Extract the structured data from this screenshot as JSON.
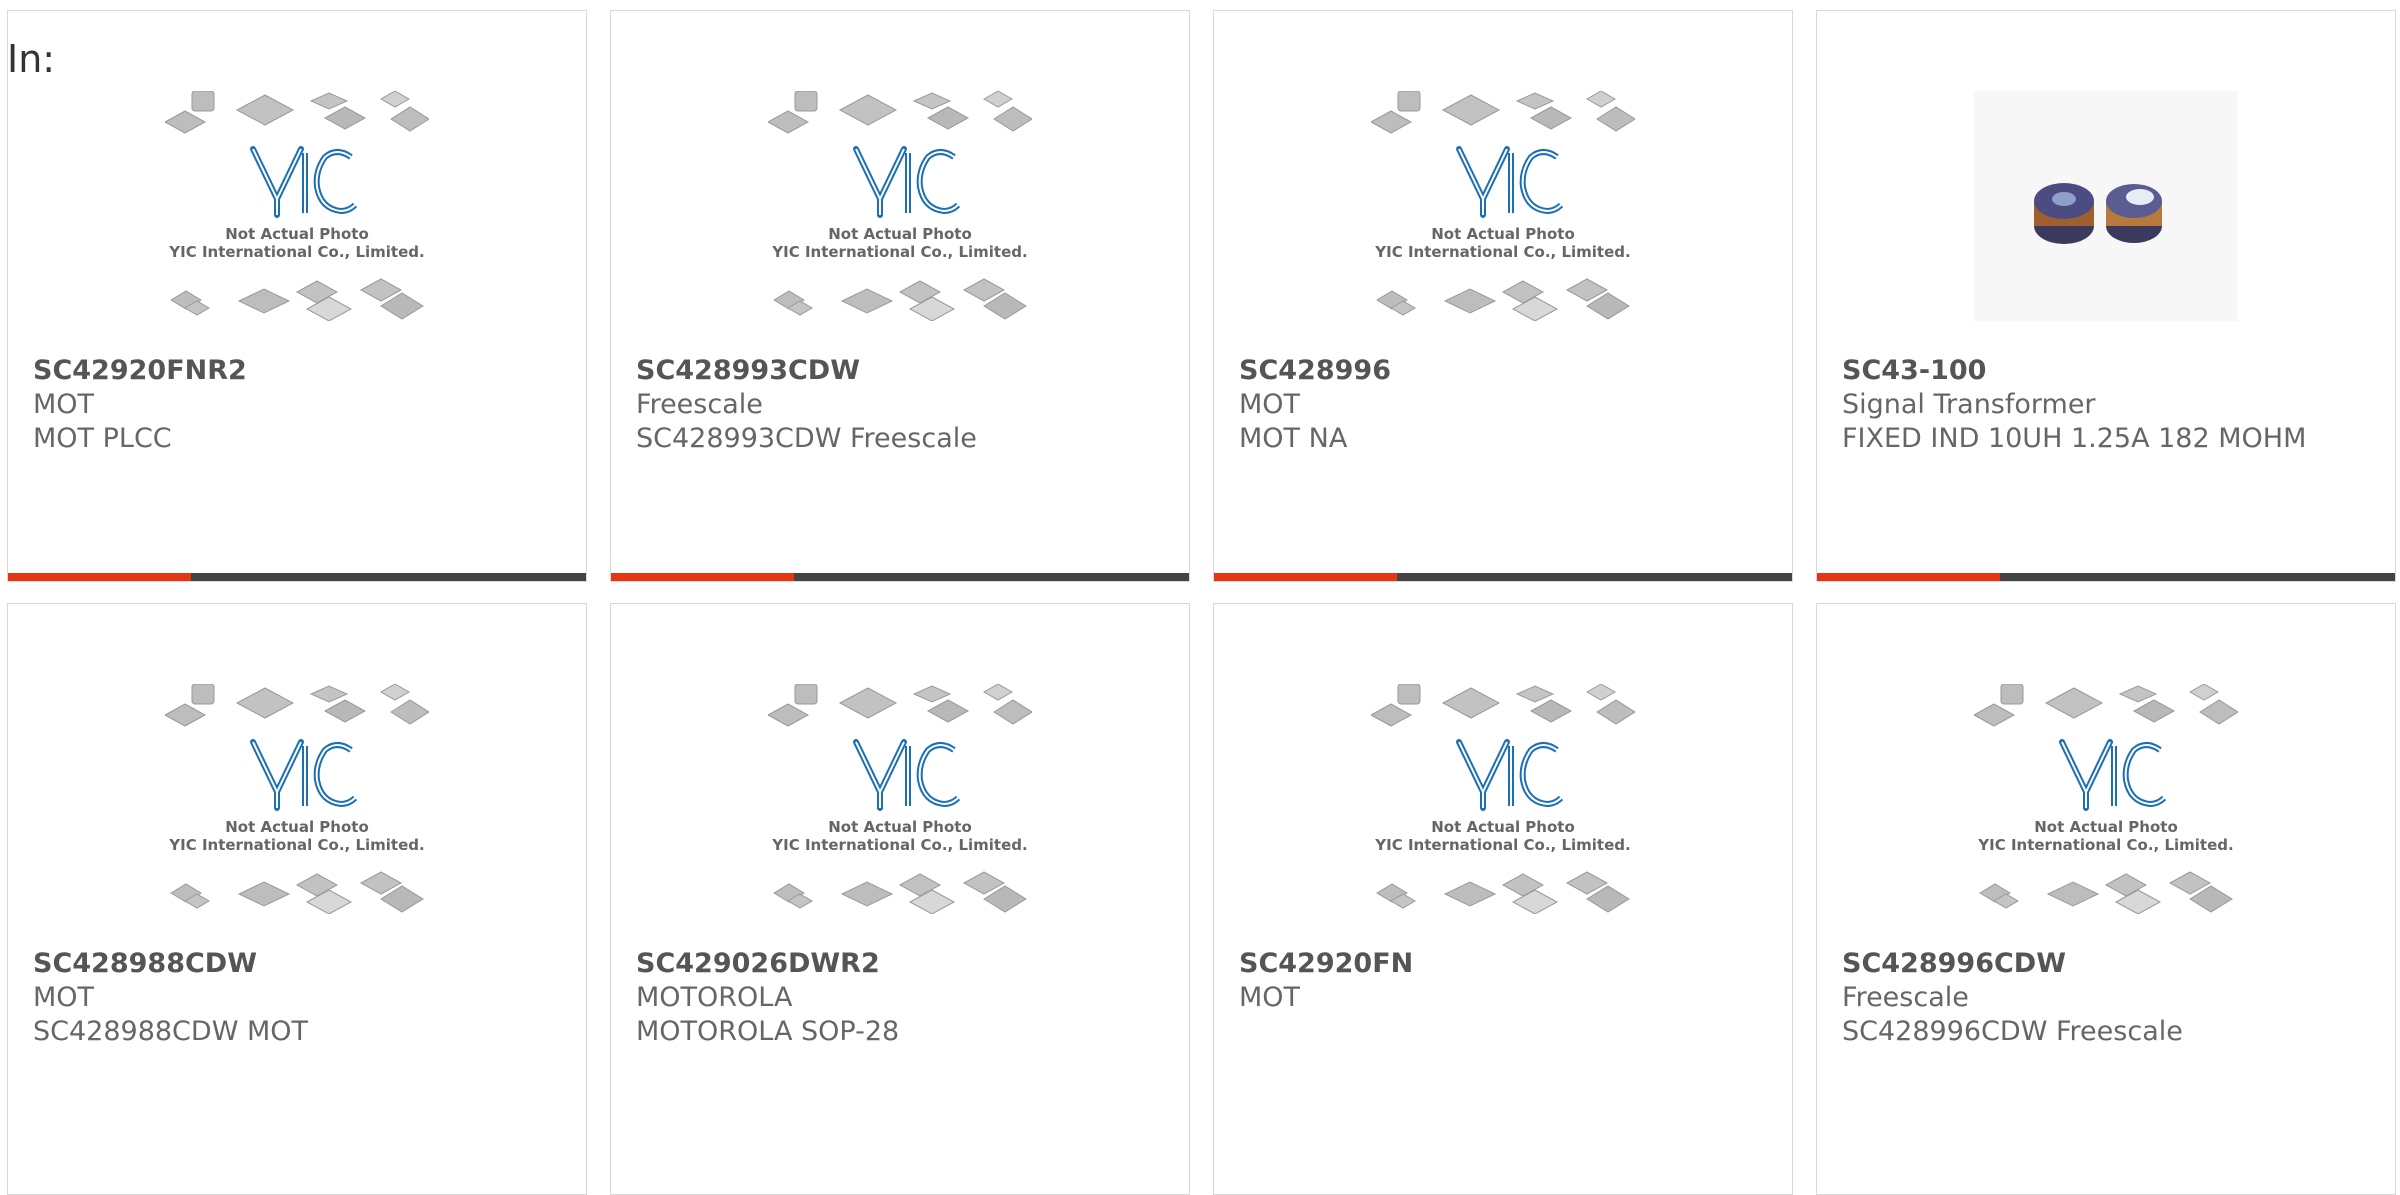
{
  "page": {
    "in_label": "In:"
  },
  "placeholder": {
    "line1": "Not Actual Photo",
    "line2": "YIC International Co., Limited."
  },
  "colors": {
    "accent": "#e63512",
    "bar": "#444444",
    "logo": "#1b6fb5"
  },
  "products": [
    {
      "part": "SC42920FNR2",
      "mfr": "MOT",
      "desc": "MOT PLCC",
      "image": "placeholder"
    },
    {
      "part": "SC428993CDW",
      "mfr": "Freescale",
      "desc": "SC428993CDW Freescale",
      "image": "placeholder"
    },
    {
      "part": "SC428996",
      "mfr": "MOT",
      "desc": "MOT NA",
      "image": "placeholder"
    },
    {
      "part": "SC43-100",
      "mfr": "Signal Transformer",
      "desc": "FIXED IND 10UH 1.25A 182 MOHM",
      "image": "inductor"
    },
    {
      "part": "SC428988CDW",
      "mfr": "MOT",
      "desc": "SC428988CDW MOT",
      "image": "placeholder"
    },
    {
      "part": "SC429026DWR2",
      "mfr": "MOTOROLA",
      "desc": "MOTOROLA SOP-28",
      "image": "placeholder"
    },
    {
      "part": "SC42920FN",
      "mfr": "MOT",
      "desc": "",
      "image": "placeholder"
    },
    {
      "part": "SC428996CDW",
      "mfr": "Freescale",
      "desc": "SC428996CDW Freescale",
      "image": "placeholder"
    }
  ]
}
